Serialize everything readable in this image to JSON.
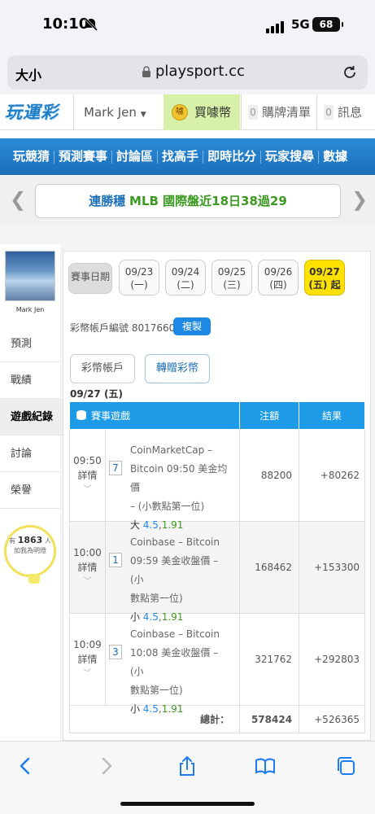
{
  "status": {
    "time": "10:10",
    "network": "5G",
    "battery": "68"
  },
  "browser": {
    "text_size": "大小",
    "url": "playsport.cc"
  },
  "header": {
    "logo": "玩運彩",
    "user_name": "Mark Jen",
    "coins_label": "買噱幣",
    "coin_icon_text": "噱",
    "cart_count": "0",
    "cart_label": "購牌清單",
    "msg_count": "0",
    "msg_label": "訊息"
  },
  "nav": [
    "玩競猜",
    "預測賽事",
    "討論區",
    "找高手",
    "即時比分",
    "玩家搜尋",
    "數據"
  ],
  "banner": {
    "part1": "連勝穩",
    "part2": "MLB 國際盤近18日38過29"
  },
  "sidebar": {
    "user_name": "Mark Jen",
    "items": [
      "預測",
      "戰績",
      "遊戲紀錄",
      "討論",
      "榮譽"
    ],
    "fans_prefix": "有",
    "fans_count": "1863",
    "fans_suffix": "人",
    "fans_text": "加我為明燈"
  },
  "main": {
    "date_label": "賽事日期",
    "dates": [
      {
        "date": "09/23",
        "day": "(一)"
      },
      {
        "date": "09/24",
        "day": "(二)"
      },
      {
        "date": "09/25",
        "day": "(三)"
      },
      {
        "date": "09/26",
        "day": "(四)"
      },
      {
        "date": "09/27",
        "day": "(五) 起"
      }
    ],
    "account_text": "彩幣帳戶編號 80176600",
    "copy_label": "複製",
    "tab_account": "彩幣帳戶",
    "tab_transfer": "轉贈彩幣",
    "current_date": "09/27 (五)",
    "table": {
      "headers": [
        "賽事遊戲",
        "注額",
        "結果"
      ],
      "rows": [
        {
          "time": "09:50",
          "detail": "詳情",
          "num": "7",
          "line1": "CoinMarketCap –",
          "line2": "Bitcoin 09:50 美金均價",
          "line3": "– (小數點第一位)",
          "pick": "大",
          "odds1": "4.5",
          "odds2": "1.91",
          "amount": "88200",
          "result": "+80262"
        },
        {
          "time": "10:00",
          "detail": "詳情",
          "num": "1",
          "line1": "Coinbase – Bitcoin",
          "line2": "09:59 美金收盤價 – (小",
          "line3": "數點第一位)",
          "pick": "小",
          "odds1": "4.5",
          "odds2": "1.91",
          "amount": "168462",
          "result": "+153300"
        },
        {
          "time": "10:09",
          "detail": "詳情",
          "num": "3",
          "line1": "Coinbase – Bitcoin",
          "line2": "10:08 美金收盤價 – (小",
          "line3": "數點第一位)",
          "pick": "小",
          "odds1": "4.5",
          "odds2": "1.91",
          "amount": "321762",
          "result": "+292803"
        }
      ],
      "total_label": "總計：",
      "total_amount": "578424",
      "total_result": "+526365"
    }
  },
  "colors": {
    "nav_blue": "#1d6fb8",
    "table_header": "#1e9be6",
    "selected_date": "#ffe100",
    "win_green": "#2e9b2e"
  }
}
